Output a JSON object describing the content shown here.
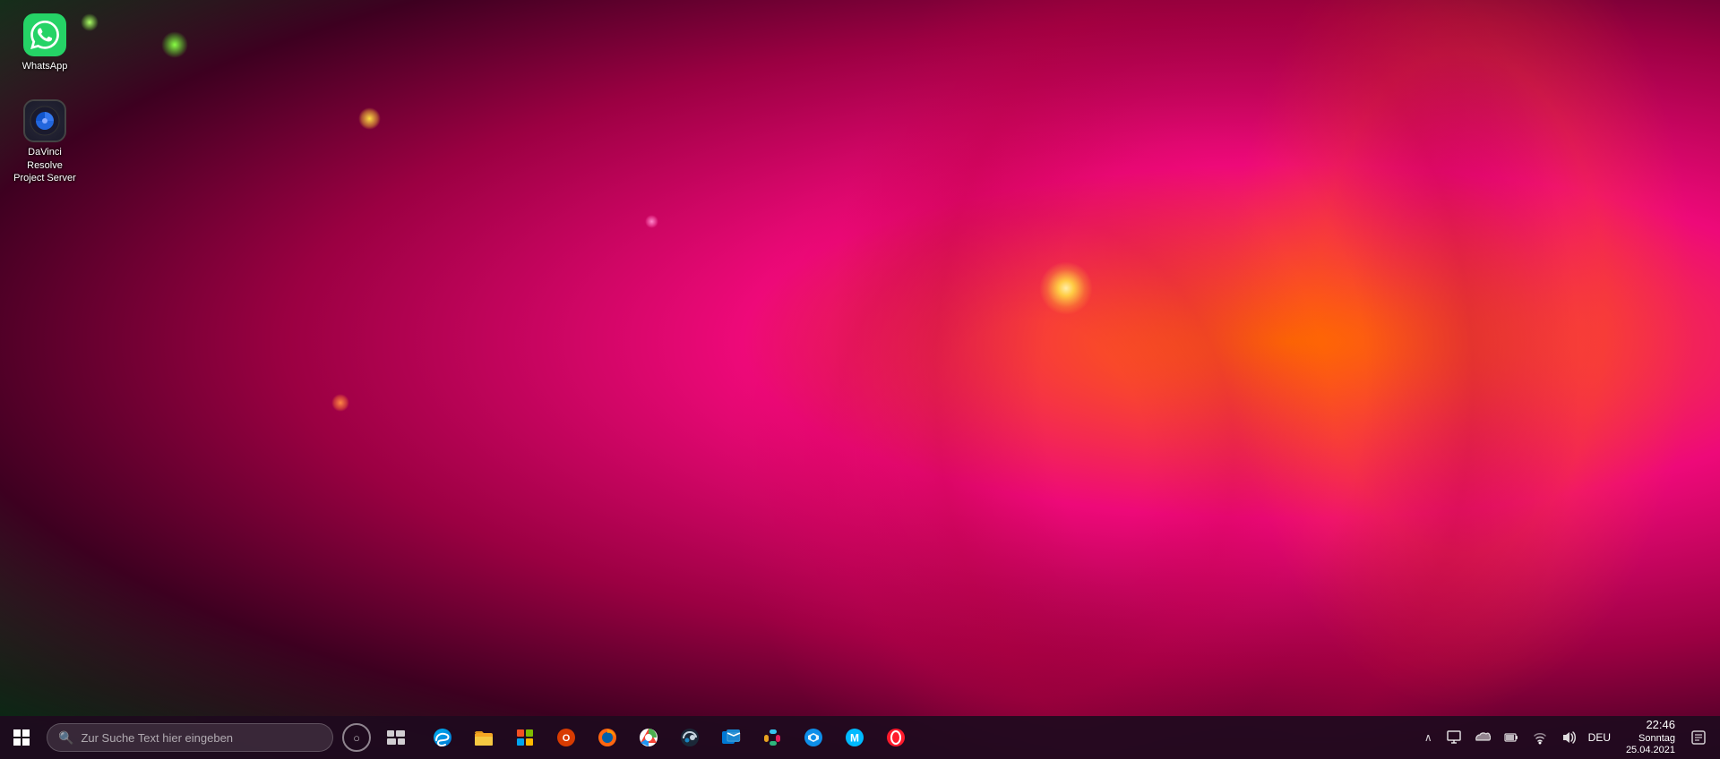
{
  "desktop": {
    "icons": [
      {
        "id": "whatsapp",
        "label": "WhatsApp",
        "type": "whatsapp"
      },
      {
        "id": "davinci",
        "label": "DaVinci Resolve\nProject Server",
        "label_line1": "DaVinci Resolve",
        "label_line2": "Project Server",
        "type": "davinci"
      }
    ]
  },
  "taskbar": {
    "search_placeholder": "Zur Suche Text hier eingeben",
    "apps": [
      {
        "id": "edge",
        "label": "Microsoft Edge",
        "color": "#0078d4"
      },
      {
        "id": "explorer",
        "label": "File Explorer",
        "color": "#f5a623"
      },
      {
        "id": "store",
        "label": "Microsoft Store",
        "color": "#0078d4"
      },
      {
        "id": "office",
        "label": "Office",
        "color": "#d83b01"
      },
      {
        "id": "firefox",
        "label": "Firefox",
        "color": "#ff6611"
      },
      {
        "id": "chrome",
        "label": "Chrome",
        "color": "#4285f4"
      },
      {
        "id": "steam",
        "label": "Steam",
        "color": "#1b2838"
      },
      {
        "id": "outlook",
        "label": "Outlook",
        "color": "#0078d4"
      },
      {
        "id": "slack",
        "label": "Slack",
        "color": "#4a154b"
      },
      {
        "id": "teamviewer",
        "label": "TeamViewer",
        "color": "#0e8ee9"
      },
      {
        "id": "malwarebytes",
        "label": "Malwarebytes",
        "color": "#00baff"
      },
      {
        "id": "opera",
        "label": "Opera",
        "color": "#ff1b2d"
      }
    ],
    "tray": {
      "language": "DEU",
      "time": "22:46",
      "day": "Sonntag",
      "date": "25.04.2021"
    }
  }
}
